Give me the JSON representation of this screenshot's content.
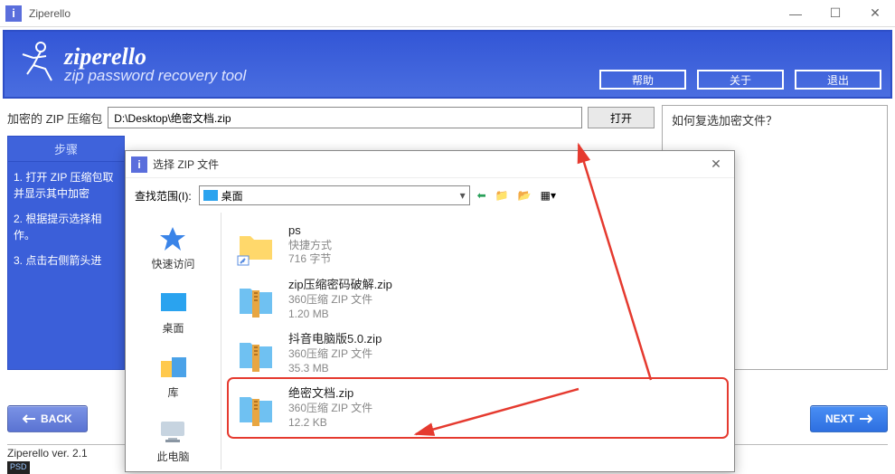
{
  "window": {
    "title": "Ziperello"
  },
  "banner": {
    "brand": "ziperello",
    "tagline": "zip password recovery tool",
    "buttons": {
      "help": "帮助",
      "about": "关于",
      "exit": "退出"
    }
  },
  "form": {
    "label": "加密的 ZIP 压缩包",
    "path_value": "D:\\Desktop\\绝密文档.zip",
    "open_label": "打开"
  },
  "hint": {
    "title": "如何复选加密文件？"
  },
  "steps": {
    "header": "步骤",
    "items": [
      "1. 打开 ZIP 压缩包取并显示其中加密",
      "2. 根据提示选择相作。",
      "3. 点击右侧箭头进"
    ]
  },
  "nav": {
    "back": "BACK",
    "next": "NEXT"
  },
  "status": {
    "version": "Ziperello ver. 2.1"
  },
  "psd_badge": "PSD",
  "dialog": {
    "title": "选择 ZIP 文件",
    "lookin_label": "查找范围(I):",
    "lookin_value": "桌面",
    "sidebar": {
      "quick": "快速访问",
      "desktop": "桌面",
      "library": "库",
      "pc": "此电脑"
    },
    "files": [
      {
        "name": "ps",
        "type": "快捷方式",
        "size": "716 字节",
        "icon": "shortcut"
      },
      {
        "name": "zip压缩密码破解.zip",
        "type": "360压缩 ZIP 文件",
        "size": "1.20 MB",
        "icon": "zip"
      },
      {
        "name": "抖音电脑版5.0.zip",
        "type": "360压缩 ZIP 文件",
        "size": "35.3 MB",
        "icon": "zip"
      },
      {
        "name": "绝密文档.zip",
        "type": "360压缩 ZIP 文件",
        "size": "12.2 KB",
        "icon": "zip"
      }
    ]
  }
}
